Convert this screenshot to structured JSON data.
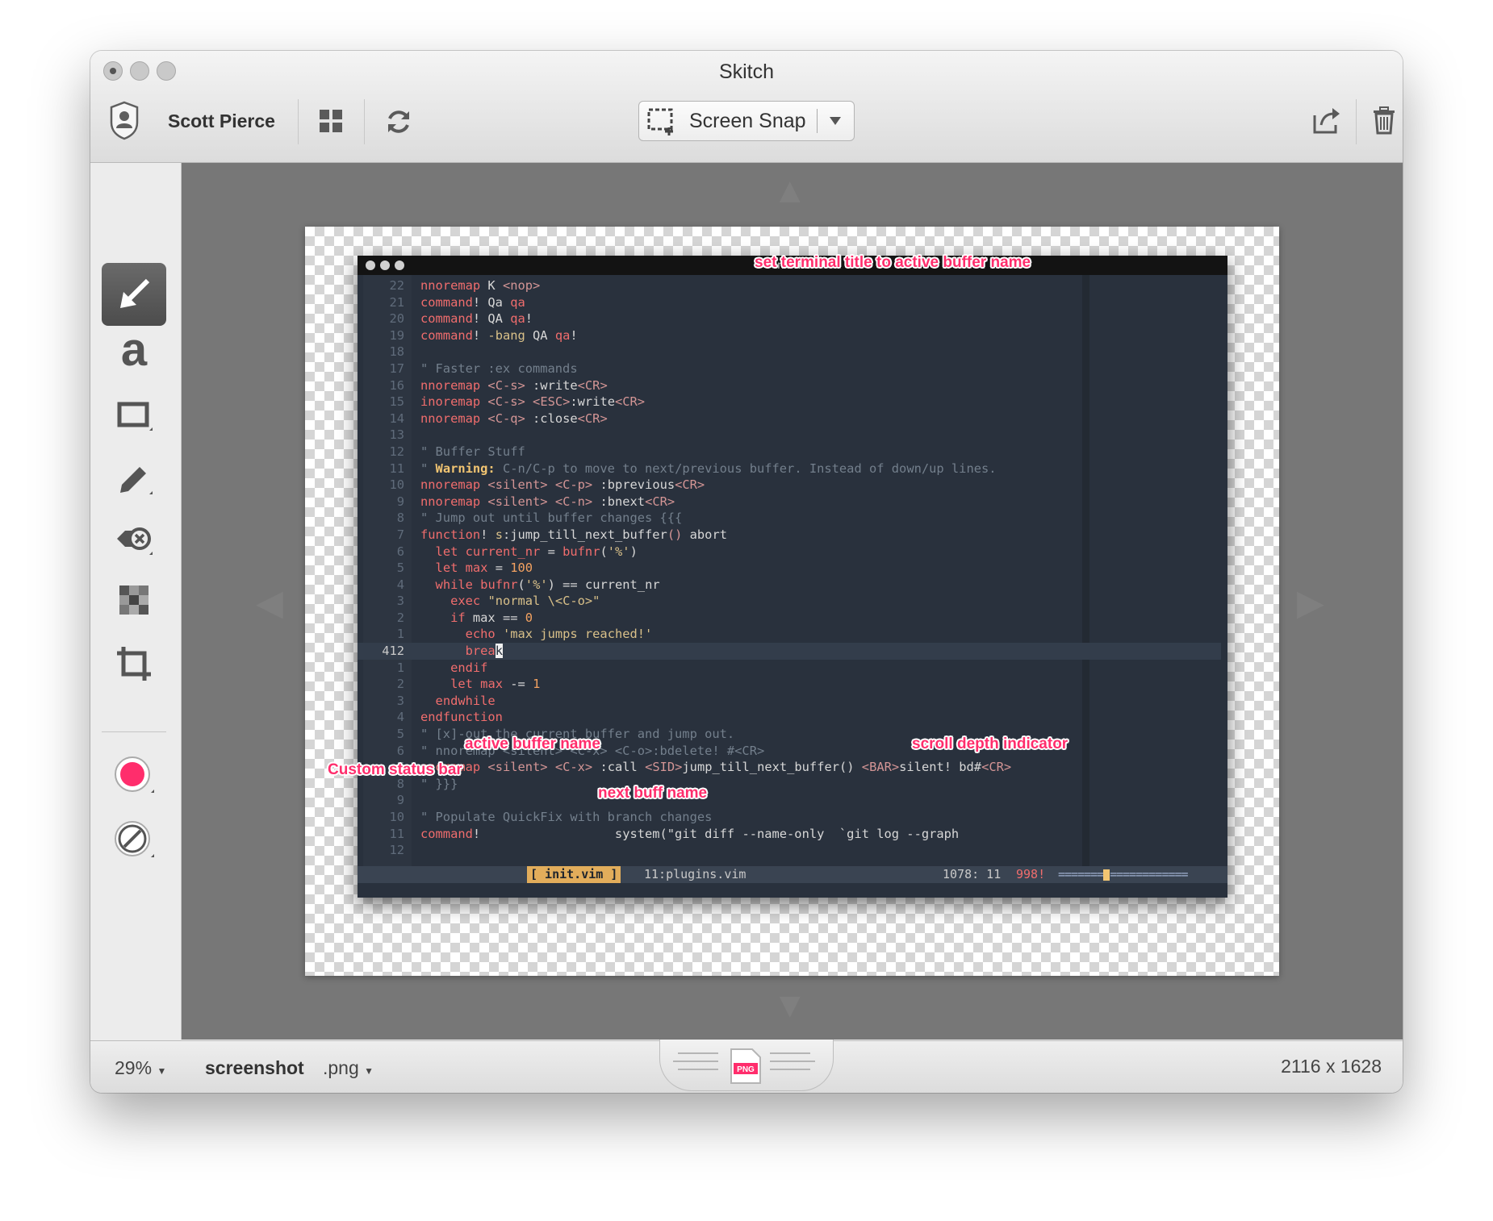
{
  "window": {
    "title": "Skitch"
  },
  "toolbar": {
    "user_name": "Scott Pierce",
    "snap_label": "Screen Snap",
    "icons": {
      "user": "user-badge-icon",
      "grid": "grid-icon",
      "refresh": "refresh-icon",
      "share": "share-icon",
      "trash": "trash-icon",
      "crop": "crop-select-icon",
      "dropdown": "chevron-down-icon"
    }
  },
  "tools": [
    "arrow-tool",
    "text-tool",
    "rectangle-tool",
    "pen-tool",
    "eraser-tool",
    "pixelate-tool",
    "crop-tool",
    "color-picker",
    "stroke-width"
  ],
  "colors": {
    "annotation": "#ff2d6c",
    "color_picker": "#ff2d6c",
    "status_active": "#e2ad5b"
  },
  "terminal": {
    "title": "init.vim"
  },
  "code_lines": [
    {
      "ln": "22",
      "html": "<span class='k'>nnoremap</span> K <span class='m'>&lt;nop&gt;</span>"
    },
    {
      "ln": "21",
      "html": "<span class='k'>command</span>! Qa <span class='k'>qa</span>"
    },
    {
      "ln": "20",
      "html": "<span class='k'>command</span>! QA <span class='k'>qa</span>!"
    },
    {
      "ln": "19",
      "html": "<span class='k'>command</span>! <span class='s'>-bang</span> QA <span class='k'>qa</span>!"
    },
    {
      "ln": "18",
      "html": ""
    },
    {
      "ln": "17",
      "html": "<span class='c'>\" Faster :ex commands</span>"
    },
    {
      "ln": "16",
      "html": "<span class='k'>nnoremap</span> <span class='m'>&lt;C-s&gt;</span> :write<span class='m'>&lt;CR&gt;</span>"
    },
    {
      "ln": "15",
      "html": "<span class='k'>inoremap</span> <span class='m'>&lt;C-s&gt;</span> <span class='m'>&lt;ESC&gt;</span>:write<span class='m'>&lt;CR&gt;</span>"
    },
    {
      "ln": "14",
      "html": "<span class='k'>nnoremap</span> <span class='m'>&lt;C-q&gt;</span> :close<span class='m'>&lt;CR&gt;</span>"
    },
    {
      "ln": "13",
      "html": ""
    },
    {
      "ln": "12",
      "html": "<span class='c'>\" Buffer Stuff</span>"
    },
    {
      "ln": "11",
      "html": "<span class='c'>\" </span><span class='y'>Warning:</span><span class='c'> C-n/C-p to move to next/previous buffer. Instead of down/up lines.</span>"
    },
    {
      "ln": "10",
      "html": "<span class='k'>nnoremap</span> <span class='m'>&lt;silent&gt;</span> <span class='m'>&lt;C-p&gt;</span> :bprevious<span class='m'>&lt;CR&gt;</span>"
    },
    {
      "ln": "9",
      "html": "<span class='k'>nnoremap</span> <span class='m'>&lt;silent&gt;</span> <span class='m'>&lt;C-n&gt;</span> :bnext<span class='m'>&lt;CR&gt;</span>"
    },
    {
      "ln": "8",
      "html": "<span class='c'>\" Jump out until buffer changes {{{</span>"
    },
    {
      "ln": "7",
      "html": "<span class='k'>function</span>! <span class='s'>s</span>:jump_till_next_buffer<span class='m'>()</span> abort"
    },
    {
      "ln": "6",
      "html": "  <span class='k'>let</span> <span class='k'>current_nr</span> = <span class='k'>bufnr</span>(<span class='s'>'%'</span>)"
    },
    {
      "ln": "5",
      "html": "  <span class='k'>let</span> <span class='k'>max</span> = <span class='n'>100</span>"
    },
    {
      "ln": "4",
      "html": "  <span class='k'>while</span> <span class='k'>bufnr</span>(<span class='s'>'%'</span>) == current_nr"
    },
    {
      "ln": "3",
      "html": "    <span class='k'>exec</span> <span class='s'>\"normal \\&lt;C-o&gt;\"</span>"
    },
    {
      "ln": "2",
      "html": "    <span class='k'>if</span> max == <span class='n'>0</span>"
    },
    {
      "ln": "1",
      "html": "      <span class='k'>echo</span> <span class='s'>'max jumps reached!'</span>"
    },
    {
      "ln": "412",
      "html": "      <span class='k'>brea</span><span class='cursor'>k</span>",
      "current": true
    },
    {
      "ln": "1",
      "html": "    <span class='k'>endif</span>"
    },
    {
      "ln": "2",
      "html": "    <span class='k'>let</span> <span class='k'>max</span> -= <span class='n'>1</span>"
    },
    {
      "ln": "3",
      "html": "  <span class='k'>endwhile</span>"
    },
    {
      "ln": "4",
      "html": "<span class='k'>endfunction</span>"
    },
    {
      "ln": "5",
      "html": "<span class='c'>\" [x]-out the current buffer and jump out.</span>"
    },
    {
      "ln": "6",
      "html": "<span class='c'>\" nnoremap &lt;silent&gt; &lt;C-x&gt; &lt;C-o&gt;:bdelete! #&lt;CR&gt;</span>"
    },
    {
      "ln": "7",
      "html": "<span class='k'>nnoremap</span> <span class='m'>&lt;silent&gt;</span> <span class='m'>&lt;C-x&gt;</span> :call <span class='m'>&lt;SID&gt;</span>jump_till_next_buffer() <span class='m'>&lt;BAR&gt;</span>silent! bd#<span class='m'>&lt;CR&gt;</span>"
    },
    {
      "ln": "8",
      "html": "<span class='c'>\" }}}</span>"
    },
    {
      "ln": "9",
      "html": ""
    },
    {
      "ln": "10",
      "html": "<span class='c'>\" Populate QuickFix with branch changes</span>"
    },
    {
      "ln": "11",
      "html": "<span class='k'>command</span>!                  system(\"git diff --name-only  `git log --graph"
    },
    {
      "ln": "12",
      "html": ""
    }
  ],
  "statusbar": {
    "active_buffer": "[ init.vim ]",
    "next_buffer": "11:plugins.vim",
    "position": "1078: 11",
    "count": "998!",
    "scroll_left": "=======",
    "scroll_right": "============"
  },
  "annotations": {
    "title": "set terminal title to active buffer name",
    "active": "active buffer name",
    "scroll": "scroll depth indicator",
    "status": "Custom status bar",
    "next": "next buff name"
  },
  "bottom": {
    "zoom": "29%",
    "filename": "screenshot",
    "extension": ".png",
    "format_icon": "png-file-icon",
    "dimensions": "2116 x 1628"
  }
}
